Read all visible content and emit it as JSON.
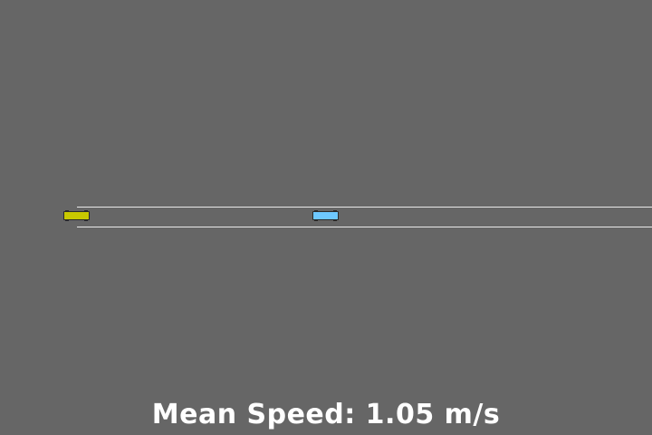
{
  "scene": {
    "background_color": "#666666",
    "lane_line_color": "#e8e8e8"
  },
  "vehicles": [
    {
      "color": "#c8c800",
      "label": "vehicle-yellow"
    },
    {
      "color": "#6ec8ff",
      "label": "vehicle-blue"
    }
  ],
  "status": {
    "text": "Mean Speed: 1.05 m/s"
  }
}
